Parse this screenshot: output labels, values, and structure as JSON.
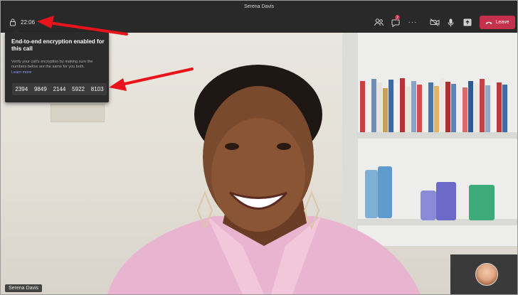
{
  "window": {
    "title": "Serena Davis"
  },
  "toolbar": {
    "timer": "22:06",
    "chat_badge_count": "2",
    "leave_label": "Leave",
    "icons": [
      "people-icon",
      "chat-icon",
      "more-icon",
      "camera-off-icon",
      "mic-icon",
      "share-icon",
      "phone-hangup-icon"
    ]
  },
  "encryption": {
    "title": "End-to-end encryption enabled for this call",
    "description": "Verify your call's encryption by making sure the numbers below are the same for you both.",
    "learn_more": "Learn more",
    "codes": [
      "2394",
      "9849",
      "2144",
      "5922",
      "8103"
    ]
  },
  "video": {
    "participant_name": "Serena Davis"
  },
  "colors": {
    "leave_red": "#c4314b",
    "toolbar_bg": "#292929",
    "panel_bg": "#2b2b2b",
    "arrow_red": "#e8131b"
  }
}
